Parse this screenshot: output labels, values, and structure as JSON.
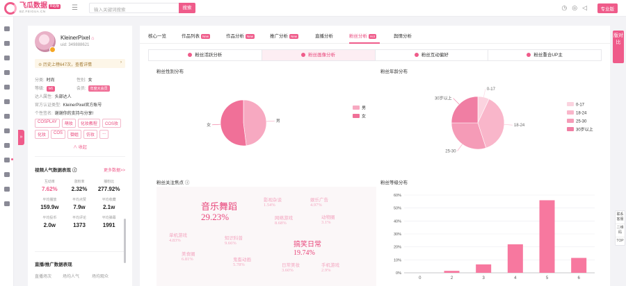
{
  "header": {
    "logo_name": "飞瓜数据",
    "logo_badge": "B站版",
    "logo_url": "BZ.FEIGUA.CN",
    "search_placeholder": "输入关键词搜索",
    "search_button": "搜索",
    "vip_button": "专业版"
  },
  "profile": {
    "nickname": "KleinerPixel",
    "uid": "uid: 349888621",
    "history_text": "历史上榜647次，查看详情",
    "category_label": "分类:",
    "category_value": "时尚",
    "gender_label": "性别:",
    "gender_value": "女",
    "level_label": "等级:",
    "level_value": "lv6",
    "member_label": "会员:",
    "member_value": "年度大会员",
    "attr_label": "达人属性:",
    "attr_value": "头部达人",
    "cert_label": "官方认证类型:",
    "cert_value": "KleinerPixel官方账号",
    "sign_label": "个性签名:",
    "sign_value": "谢谢你的支持与分享!",
    "tags": [
      "COSPLAY",
      "萌妆",
      "化妆教程",
      "COS妆",
      "化妆",
      "COS",
      "御姐",
      "仿妆",
      "..."
    ],
    "collapse": "收起",
    "recent_title": "视频人气数据表现",
    "recent_more": "更多数据>>",
    "stats": [
      {
        "label": "互动率",
        "value": "7.62%",
        "pink": true
      },
      {
        "label": "涨粉率",
        "value": "2.32%",
        "pink": false
      },
      {
        "label": "播粉比",
        "value": "277.92%",
        "pink": false
      },
      {
        "label": "平均播放",
        "value": "159.9w",
        "pink": false
      },
      {
        "label": "平均点赞",
        "value": "7.9w",
        "pink": false
      },
      {
        "label": "平均收藏",
        "value": "2.1w",
        "pink": false
      },
      {
        "label": "平均投币",
        "value": "2.0w",
        "pink": false
      },
      {
        "label": "平均评论",
        "value": "1373",
        "pink": false
      },
      {
        "label": "平均弹幕",
        "value": "1991",
        "pink": false
      }
    ],
    "live_title": "直播/推广数据表现",
    "live_labels": [
      "直播场次",
      "场均人气",
      "场均观众"
    ]
  },
  "tabs": [
    {
      "label": "核心一览",
      "new": false,
      "active": false
    },
    {
      "label": "作品列表",
      "new": true,
      "active": false
    },
    {
      "label": "作品分析",
      "new": true,
      "active": false
    },
    {
      "label": "推广分析",
      "new": true,
      "active": false
    },
    {
      "label": "直播分析",
      "new": false,
      "active": false
    },
    {
      "label": "粉丝分析",
      "new": true,
      "badge": "Hot",
      "active": true
    },
    {
      "label": "舆情分析",
      "new": false,
      "active": false
    }
  ],
  "new_badge": "New",
  "subtabs": [
    {
      "label": "粉丝活跃分析",
      "active": false
    },
    {
      "label": "粉丝画像分析",
      "active": true
    },
    {
      "label": "粉丝互动偏好",
      "active": false
    },
    {
      "label": "粉丝重合UP主",
      "active": false
    }
  ],
  "panels": {
    "gender_title": "粉丝性别分布",
    "age_title": "粉丝年龄分布",
    "focus_title": "粉丝关注焦点",
    "level_title": "粉丝等级分布"
  },
  "colors": {
    "accent": "#ef5b8a",
    "light_pink": "#f7a9c1",
    "bar": "#f7789f"
  },
  "chart_data": [
    {
      "type": "pie",
      "title": "粉丝性别分布",
      "categories": [
        "男",
        "女"
      ],
      "values": [
        48,
        52
      ],
      "legend": "right"
    },
    {
      "type": "pie",
      "title": "粉丝年龄分布",
      "categories": [
        "0-17",
        "18-24",
        "25-30",
        "30岁以上"
      ],
      "values": [
        7,
        38,
        30,
        25
      ],
      "legend": "right"
    },
    {
      "type": "bar",
      "title": "粉丝等级分布",
      "categories": [
        "0",
        "2",
        "3",
        "4",
        "5",
        "6"
      ],
      "values": [
        0,
        1.5,
        6.5,
        22,
        56,
        11.5
      ],
      "ylim": [
        0,
        60
      ],
      "yticks": [
        "0%",
        "10%",
        "20%",
        "30%",
        "40%",
        "50%",
        "60%"
      ]
    }
  ],
  "word_cloud": [
    {
      "name": "音乐舞蹈",
      "pct": "29.23%",
      "size": "big"
    },
    {
      "name": "搞笑日常",
      "pct": "19.74%",
      "size": "mid"
    },
    {
      "name": "影视杂谈",
      "pct": "1.54%",
      "size": "small"
    },
    {
      "name": "娱乐广告",
      "pct": "4.97%",
      "size": "small"
    },
    {
      "name": "网络游戏",
      "pct": "8.68%",
      "size": "small"
    },
    {
      "name": "动物圈",
      "pct": "3.1%",
      "size": "small"
    },
    {
      "name": "单机游戏",
      "pct": "4.83%",
      "size": "small"
    },
    {
      "name": "知识科普",
      "pct": "9.66%",
      "size": "small"
    },
    {
      "name": "美食圈",
      "pct": "6.81%",
      "size": "small"
    },
    {
      "name": "鬼畜动画",
      "pct": "5.78%",
      "size": "small"
    },
    {
      "name": "日常美妆",
      "pct": "3.60%",
      "size": "small"
    },
    {
      "name": "手机游戏",
      "pct": "2.9%",
      "size": "small"
    }
  ],
  "right_float": "版对比",
  "right_tools": [
    "联系客服",
    "二维码",
    "TOP"
  ]
}
